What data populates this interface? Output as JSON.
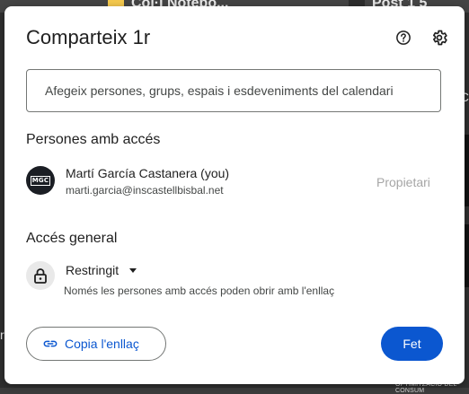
{
  "background": {
    "file_left_label": "Col·l Notebo...",
    "file_right_label": "Post 1 5",
    "left_partial_text": "ret",
    "right_partial_text": "C",
    "bottom_partial_text": "OPTIMITZACIÓ DEL CONSUM"
  },
  "dialog": {
    "title": "Comparteix 1r",
    "help_icon": "help-icon",
    "settings_icon": "gear-icon",
    "add_people_placeholder": "Afegeix persones, grups, espais i esdeveniments del calendari",
    "people_section_title": "Persones amb accés",
    "people": [
      {
        "avatar_text": "MGC",
        "name": "Martí García Castanera (you)",
        "email": "marti.garcia@inscastellbisbal.net",
        "role": "Propietari"
      }
    ],
    "general_access": {
      "section_title": "Accés general",
      "icon": "lock-icon",
      "selected_option": "Restringit",
      "description": "Només les persones amb accés poden obrir amb l'enllaç"
    },
    "copy_link_label": "Copia l'enllaç",
    "done_label": "Fet"
  },
  "colors": {
    "accent": "#0b57d0",
    "text_primary": "#1f1f1f",
    "text_secondary": "#444746",
    "role_text": "#a6a6a6"
  }
}
